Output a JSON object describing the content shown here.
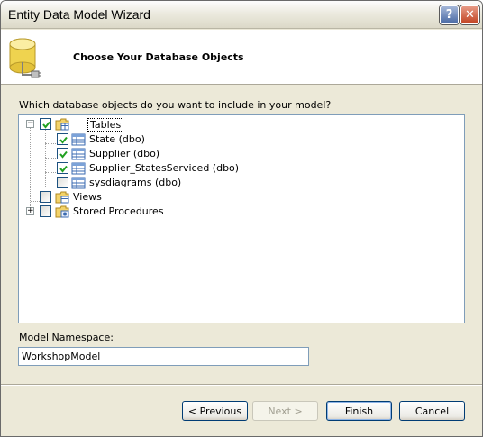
{
  "window": {
    "title": "Entity Data Model Wizard"
  },
  "titlebar_buttons": {
    "help": "?",
    "close": "✕"
  },
  "header": {
    "title": "Choose Your Database Objects",
    "icon": "database-connect-icon"
  },
  "prompt": "Which database objects do you want to include in your model?",
  "tree": {
    "tables": {
      "label": "Tables",
      "checked": true,
      "expanded": true,
      "items": [
        {
          "label": "State (dbo)",
          "checked": true
        },
        {
          "label": "Supplier (dbo)",
          "checked": true
        },
        {
          "label": "Supplier_StatesServiced (dbo)",
          "checked": true
        },
        {
          "label": "sysdiagrams (dbo)",
          "checked": false
        }
      ]
    },
    "views": {
      "label": "Views",
      "checked": false
    },
    "procedures": {
      "label": "Stored Procedures",
      "checked": false,
      "expanded": false
    }
  },
  "namespace": {
    "label": "Model Namespace:",
    "value": "WorkshopModel"
  },
  "buttons": {
    "previous": "< Previous",
    "next": "Next >",
    "finish": "Finish",
    "cancel": "Cancel"
  },
  "colors": {
    "accent": "#003c74",
    "check": "#21a121"
  }
}
